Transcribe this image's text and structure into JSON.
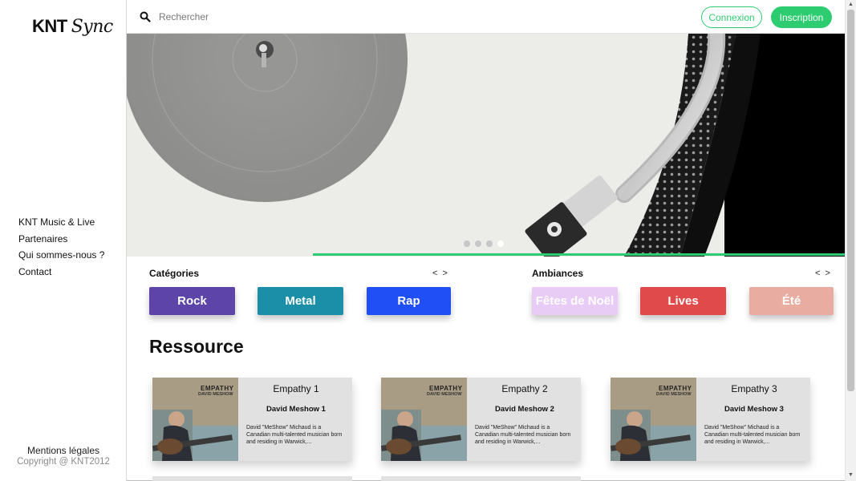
{
  "brand": {
    "name_bold": "KNT",
    "name_script": "Sync"
  },
  "sidebar": {
    "items": [
      {
        "label": "KNT Music & Live"
      },
      {
        "label": "Partenaires"
      },
      {
        "label": "Qui sommes-nous ?"
      },
      {
        "label": "Contact"
      }
    ],
    "footer": {
      "legal": "Mentions légales",
      "copyright": "Copyright @ KNT2012"
    }
  },
  "header": {
    "search_placeholder": "Rechercher",
    "login_label": "Connexion",
    "signup_label": "Inscription"
  },
  "carousel": {
    "slides": 4,
    "active_index": 3
  },
  "categories": {
    "title": "Catégories",
    "prev": "<",
    "next": ">",
    "items": [
      {
        "label": "Rock",
        "color": "#5c44a8"
      },
      {
        "label": "Metal",
        "color": "#1a8fa7"
      },
      {
        "label": "Rap",
        "color": "#1f4ff5"
      }
    ]
  },
  "ambiances": {
    "title": "Ambiances",
    "prev": "<",
    "next": ">",
    "items": [
      {
        "label": "Fêtes de Noël",
        "color": "#e8ccf5"
      },
      {
        "label": "Lives",
        "color": "#e04a4a"
      },
      {
        "label": "Été",
        "color": "#e8ada0"
      }
    ]
  },
  "resources": {
    "title": "Ressource",
    "cards": [
      {
        "title": "Empathy 1",
        "artist": "David Meshow 1",
        "description": "David \"MeShow\" Michaud is a Canadian multi-talented musician born and residing in Warwick,...",
        "cover_title": "EMPATHY",
        "cover_artist": "DAVID MESHOW"
      },
      {
        "title": "Empathy 2",
        "artist": "David Meshow 2",
        "description": "David \"MeShow\" Michaud is a Canadian multi-talented musician born and residing in Warwick,...",
        "cover_title": "EMPATHY",
        "cover_artist": "DAVID MESHOW"
      },
      {
        "title": "Empathy 3",
        "artist": "David Meshow 3",
        "description": "David \"MeShow\" Michaud is a Canadian multi-talented musician born and residing in Warwick,...",
        "cover_title": "EMPATHY",
        "cover_artist": "DAVID MESHOW"
      }
    ]
  },
  "colors": {
    "accent": "#2ecc71"
  }
}
